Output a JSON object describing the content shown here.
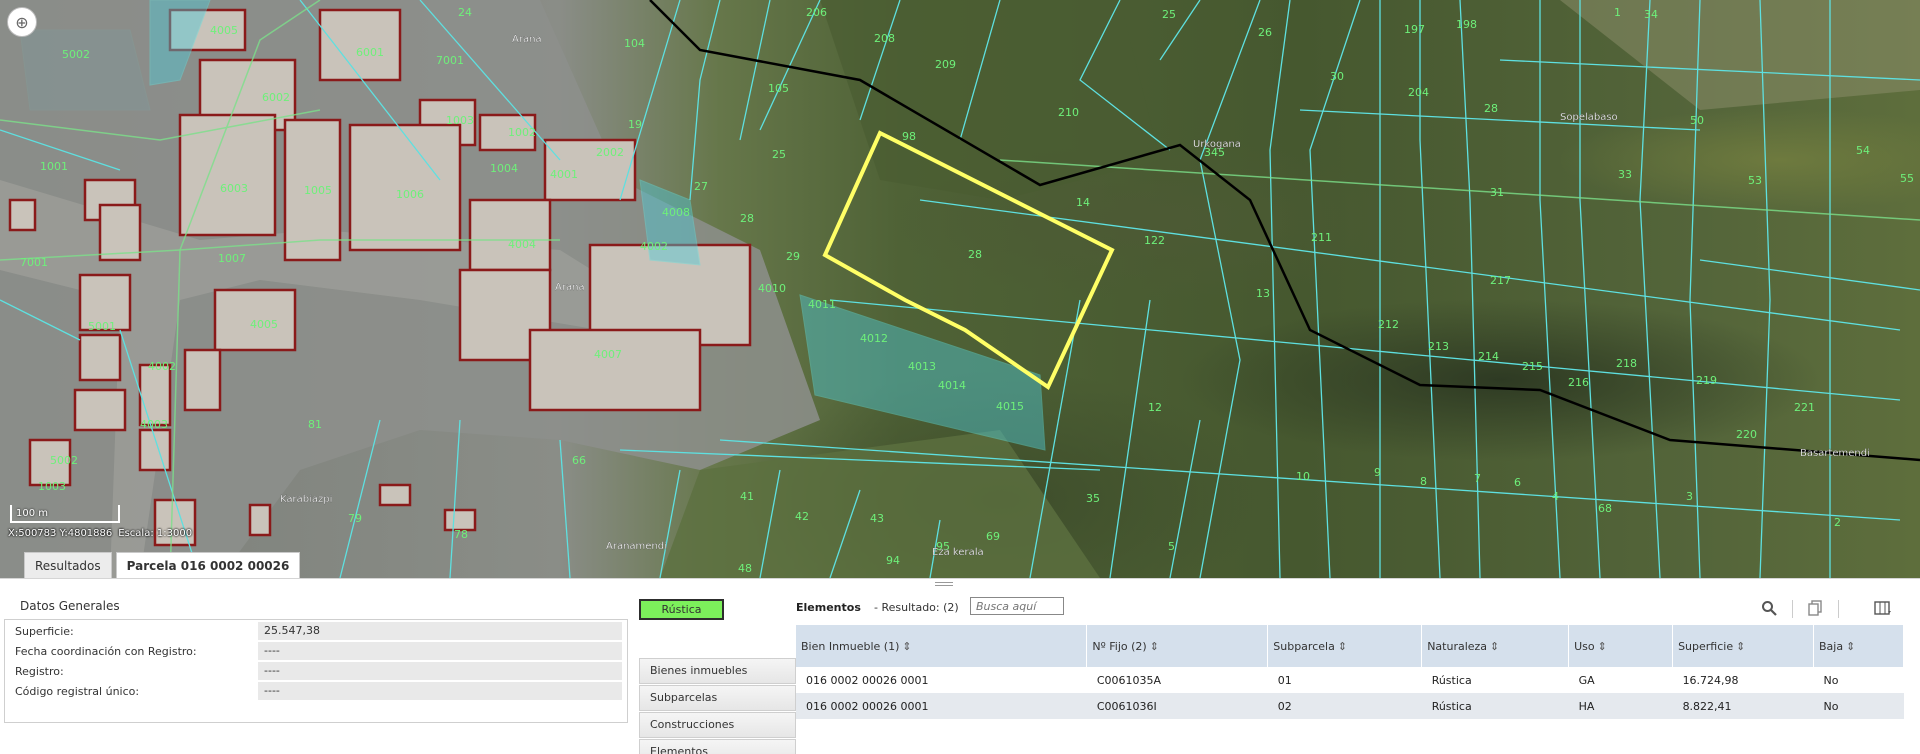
{
  "map": {
    "labels": {
      "parcels_urban": [
        "5002",
        "4005",
        "6001",
        "7001",
        "6002",
        "1003",
        "1002",
        "2002",
        "1001",
        "4001",
        "6003",
        "1005",
        "1006",
        "1004",
        "7001",
        "4004",
        "1007",
        "4008",
        "4002",
        "5001",
        "4005",
        "4010",
        "4011",
        "4007",
        "4012",
        "4002",
        "4003",
        "4013",
        "4014",
        "5002",
        "4015",
        "1003"
      ],
      "parcels_rural": [
        "24",
        "104",
        "206",
        "208",
        "209",
        "105",
        "210",
        "98",
        "25",
        "19",
        "27",
        "28",
        "29",
        "14",
        "28",
        "345",
        "122",
        "13",
        "12",
        "211",
        "212",
        "213",
        "214",
        "215",
        "216",
        "217",
        "218",
        "219",
        "220",
        "221",
        "197",
        "198",
        "204",
        "28",
        "30",
        "26",
        "25",
        "34",
        "31",
        "33",
        "50",
        "53",
        "54",
        "55",
        "66",
        "81",
        "41",
        "42",
        "43",
        "95",
        "69",
        "94",
        "35",
        "10",
        "9",
        "8",
        "7",
        "6",
        "5",
        "4",
        "68",
        "3",
        "2",
        "48",
        "78",
        "79",
        "1",
        "4004"
      ],
      "places": [
        "Arana",
        "Arana",
        "Urkogana",
        "Sopelabaso",
        "Basartemendi",
        "Karabiazpi",
        "Aranamendi",
        "Eza kerala"
      ]
    },
    "scale_label": "100 m",
    "coords": {
      "xy": "X:500783 Y:4801886",
      "scale": "Escala: 1:3000"
    },
    "colors": {
      "parcel_line": "#5ee0e0",
      "urban_line": "#8a1a1a",
      "selected": "#ffff66",
      "boundary": "#000000",
      "label": "#6ef07a"
    }
  },
  "tabs": [
    {
      "label": "Resultados"
    },
    {
      "label": "Parcela 016 0002 00026"
    }
  ],
  "datos": {
    "title": "Datos Generales",
    "rows": [
      {
        "label": "Superficie:",
        "value": "25.547,38"
      },
      {
        "label": "Fecha coordinación con Registro:",
        "value": "----"
      },
      {
        "label": "Registro:",
        "value": "----"
      },
      {
        "label": "Código registral único:",
        "value": "----"
      }
    ]
  },
  "badge": {
    "label": "Rústica",
    "color": "#7cf05b"
  },
  "side_menu": [
    {
      "label": "Bienes inmuebles"
    },
    {
      "label": "Subparcelas"
    },
    {
      "label": "Construcciones"
    },
    {
      "label": "Elementos"
    }
  ],
  "elementos": {
    "title": "Elementos",
    "result": "- Resultado: (2)",
    "search_placeholder": "Busca aquí",
    "columns": [
      "Bien Inmueble (1)",
      "Nº Fijo (2)",
      "Subparcela",
      "Naturaleza",
      "Uso",
      "Superficie",
      "Baja"
    ],
    "rows": [
      [
        "016 0002 00026 0001",
        "C0061035A",
        "01",
        "Rústica",
        "GA",
        "16.724,98",
        "No"
      ],
      [
        "016 0002 00026 0001",
        "C0061036I",
        "02",
        "Rústica",
        "HA",
        "8.822,41",
        "No"
      ]
    ]
  }
}
